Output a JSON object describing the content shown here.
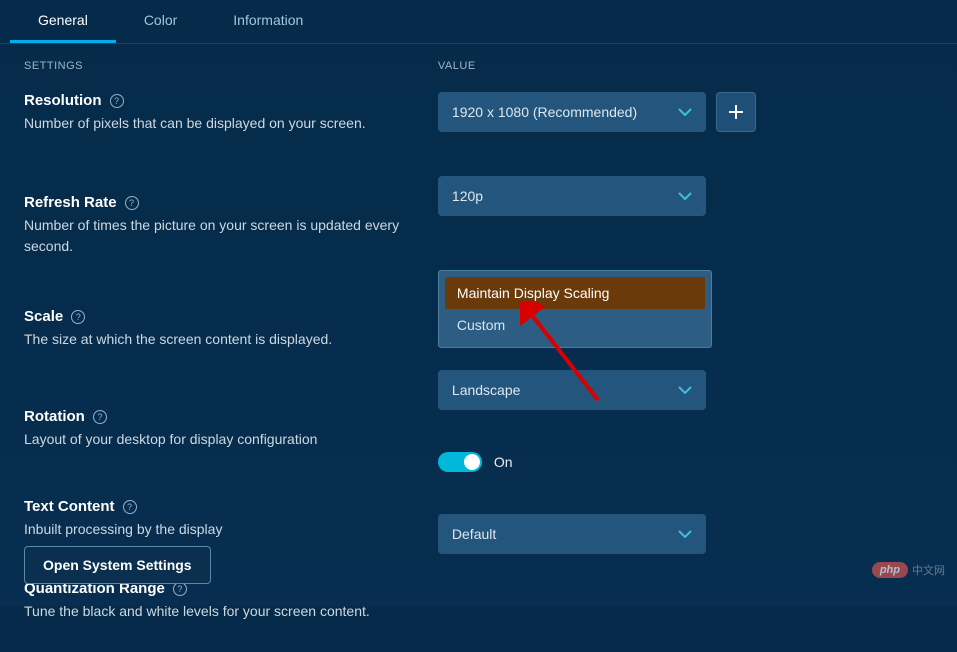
{
  "tabs": {
    "general": "General",
    "color": "Color",
    "information": "Information"
  },
  "headers": {
    "settings": "SETTINGS",
    "value": "VALUE"
  },
  "settings": {
    "resolution": {
      "title": "Resolution",
      "desc": "Number of pixels that can be displayed on your screen.",
      "value": "1920 x 1080 (Recommended)"
    },
    "refresh": {
      "title": "Refresh Rate",
      "desc": "Number of times the picture on your screen is updated every second.",
      "value": "120p"
    },
    "scale": {
      "title": "Scale",
      "desc": "The size at which the screen content is displayed.",
      "options": {
        "maintain": "Maintain Display Scaling",
        "custom": "Custom"
      }
    },
    "rotation": {
      "title": "Rotation",
      "desc": "Layout of your desktop for display configuration",
      "value": "Landscape"
    },
    "text": {
      "title": "Text Content",
      "desc": "Inbuilt processing by the display",
      "state": "On"
    },
    "quant": {
      "title": "Quantization Range",
      "desc": "Tune the black and white levels for your screen content.",
      "value": "Default"
    }
  },
  "footer": {
    "button": "Open System Settings"
  },
  "watermark": {
    "badge": "php",
    "text": "中文网"
  }
}
